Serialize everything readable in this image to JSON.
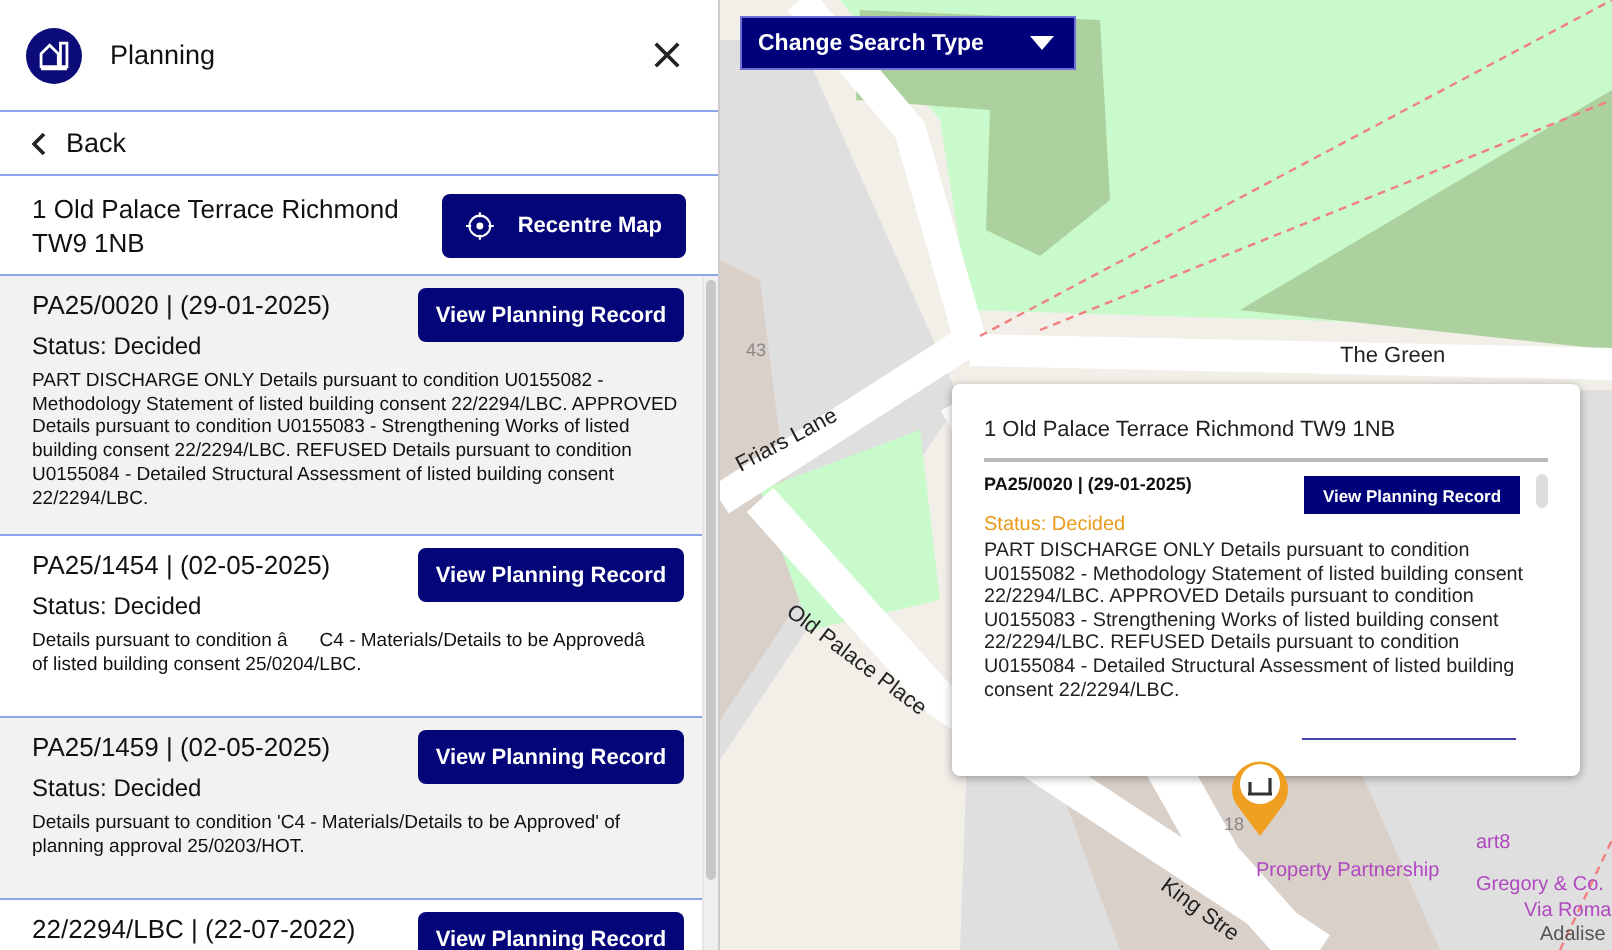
{
  "panel": {
    "title": "Planning",
    "back": "Back",
    "address": "1 Old Palace Terrace Richmond TW9 1NB",
    "recentre_button": "Recentre Map",
    "records": [
      {
        "reference": "PA25/0020 | (29-01-2025)",
        "status": "Status: Decided",
        "description": "PART DISCHARGE ONLY Details pursuant to condition U0155082 - Methodology Statement of listed building consent 22/2294/LBC. APPROVED Details pursuant to condition U0155083 - Strengthening Works of listed building consent 22/2294/LBC. REFUSED Details pursuant to condition U0155084 - Detailed Structural Assessment of listed building consent 22/2294/LBC.",
        "button": "View Planning Record"
      },
      {
        "reference": "PA25/1454 | (02-05-2025)",
        "status": "Status: Decided",
        "description": "Details pursuant to condition âC4 - Materials/Details to be Approvedâ of listed building consent 25/0204/LBC.",
        "button": "View Planning Record"
      },
      {
        "reference": "PA25/1459 | (02-05-2025)",
        "status": "Status: Decided",
        "description": "Details pursuant to condition 'C4 - Materials/Details to be Approved' of planning approval 25/0203/HOT.",
        "button": "View Planning Record"
      },
      {
        "reference": "22/2294/LBC | (22-07-2022)",
        "button": "View Planning Record"
      }
    ]
  },
  "map": {
    "search_type_button": "Change Search Type",
    "labels": [
      {
        "text": "43",
        "kind": "house"
      },
      {
        "text": "The Green",
        "kind": "street"
      },
      {
        "text": "Friars Lane",
        "kind": "street"
      },
      {
        "text": "Old Palace Place",
        "kind": "street"
      },
      {
        "text": "King Stre",
        "kind": "street"
      },
      {
        "text": "18",
        "kind": "house"
      },
      {
        "text": "Property Partnership",
        "kind": "poi"
      },
      {
        "text": "art8",
        "kind": "poi"
      },
      {
        "text": "Gregory & Co.",
        "kind": "poi"
      },
      {
        "text": "Via Roma",
        "kind": "poi"
      },
      {
        "text": "Adalise",
        "kind": "place"
      }
    ],
    "popup": {
      "title": "1 Old Palace Terrace Richmond TW9 1NB",
      "record": {
        "reference": "PA25/0020 | (29-01-2025)",
        "status": "Status: Decided",
        "description": "PART DISCHARGE ONLY Details pursuant to condition U0155082 - Methodology Statement of listed building consent 22/2294/LBC. APPROVED Details pursuant to condition U0155083 - Strengthening Works of listed building consent 22/2294/LBC. REFUSED Details pursuant to condition U0155084 - Detailed Structural Assessment of listed building consent 22/2294/LBC.",
        "button": "View Planning Record"
      }
    }
  }
}
